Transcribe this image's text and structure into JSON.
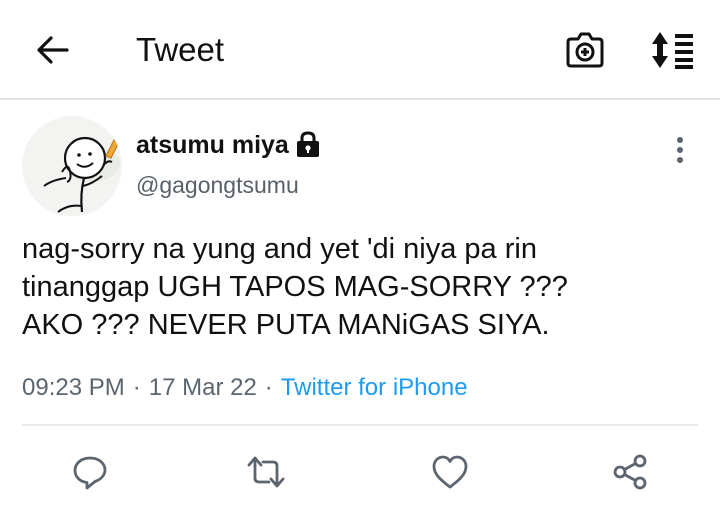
{
  "header": {
    "title": "Tweet",
    "back_icon": "arrow-left-icon",
    "camera_icon": "camera-icon",
    "sort_icon": "sort-icon"
  },
  "tweet": {
    "author": {
      "display_name": "atsumu miya",
      "handle": "@gagongtsumu",
      "protected_icon": "lock-icon"
    },
    "text_lines": [
      "nag-sorry na yung and yet 'di niya pa rin",
      "tinanggap UGH TAPOS MAG-SORRY ???",
      "AKO ??? NEVER PUTA MANiGAS SIYA."
    ],
    "time": "09:23 PM",
    "separator": "·",
    "date": "17 Mar 22",
    "source": "Twitter for iPhone"
  },
  "actions": {
    "reply_icon": "reply-icon",
    "retweet_icon": "retweet-icon",
    "like_icon": "heart-icon",
    "share_icon": "share-icon"
  },
  "colors": {
    "link": "#1d9bf0",
    "meta": "#5b6570",
    "divider": "#dfe3e6",
    "text": "#111111"
  }
}
